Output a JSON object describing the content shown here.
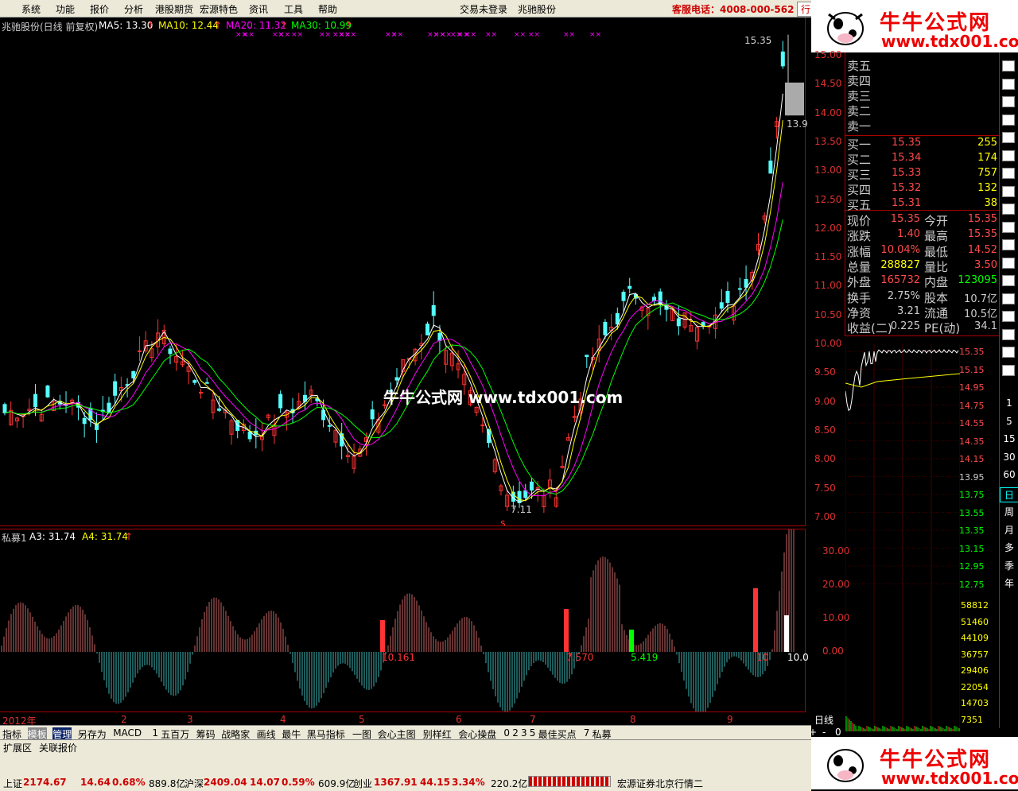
{
  "menu": [
    "系统",
    "功能",
    "报价",
    "分析",
    "港股期货",
    "宏源特色",
    "资讯",
    "工具",
    "帮助"
  ],
  "login_status": "交易未登录",
  "stock_name_menu": "兆驰股份",
  "hotline": "客服电话：4008-000-562",
  "hotline_tab": "行",
  "logo": {
    "title": "牛牛公式网",
    "url": "www.tdx001.com"
  },
  "watermark": "牛牛公式网 www.tdx001.com",
  "main_legend": {
    "name": "兆驰股份(日线 前复权)",
    "ma5": "MA5: 13.30",
    "ma10": "MA10: 12.44",
    "ma20": "MA20: 11.32",
    "ma30": "MA30: 10.99",
    "arrow": "↑"
  },
  "main_y_ticks": [
    "15.00",
    "14.50",
    "14.00",
    "13.50",
    "13.00",
    "12.50",
    "12.00",
    "11.50",
    "11.00",
    "10.50",
    "10.00",
    "9.50",
    "9.00",
    "8.50",
    "8.00",
    "7.50",
    "7.00"
  ],
  "high_label": "15.35",
  "low_label": "7.11",
  "right_low_label": "13.9",
  "sub_legend": {
    "name": "私募1",
    "a3": "A3: 31.74",
    "a4": "A4: 31.74"
  },
  "sub_y_ticks": [
    "30.00",
    "20.00",
    "10.00",
    "0.00"
  ],
  "sub_labels": [
    "10.161",
    "7.570",
    "5.419",
    "10",
    "10.0"
  ],
  "x_labels": [
    "2012年",
    "2",
    "3",
    "4",
    "5",
    "6",
    "7",
    "8",
    "9"
  ],
  "period_label": "日线",
  "zoom_buttons": [
    "+",
    "-",
    "0"
  ],
  "quote": {
    "sells": [
      {
        "label": "卖五"
      },
      {
        "label": "卖四"
      },
      {
        "label": "卖三"
      },
      {
        "label": "卖二"
      },
      {
        "label": "卖一"
      }
    ],
    "buys": [
      {
        "label": "买一",
        "price": "15.35",
        "vol": "255"
      },
      {
        "label": "买二",
        "price": "15.34",
        "vol": "174"
      },
      {
        "label": "买三",
        "price": "15.33",
        "vol": "757"
      },
      {
        "label": "买四",
        "price": "15.32",
        "vol": "132"
      },
      {
        "label": "买五",
        "price": "15.31",
        "vol": "38"
      }
    ],
    "stats": [
      {
        "l1": "现价",
        "v1": "15.35",
        "l2": "今开",
        "v2": "15.35"
      },
      {
        "l1": "涨跌",
        "v1": "1.40",
        "l2": "最高",
        "v2": "15.35"
      },
      {
        "l1": "涨幅",
        "v1": "10.04%",
        "l2": "最低",
        "v2": "14.52"
      },
      {
        "l1": "总量",
        "v1": "288827",
        "l2": "量比",
        "v2": "3.50"
      },
      {
        "l1": "外盘",
        "v1": "165732",
        "l2": "内盘",
        "v2": "123095"
      },
      {
        "l1": "换手",
        "v1": "2.75%",
        "l2": "股本",
        "v2": "10.7亿"
      },
      {
        "l1": "净资",
        "v1": "3.21",
        "l2": "流通",
        "v2": "10.5亿"
      },
      {
        "l1": "收益(二)",
        "v1": "0.225",
        "l2": "PE(动)",
        "v2": "34.1"
      }
    ]
  },
  "mini_price_ticks": [
    "15.35",
    "15.15",
    "14.95",
    "14.75",
    "14.55",
    "14.35",
    "14.15",
    "13.95",
    "13.75",
    "13.55",
    "13.35",
    "13.15",
    "12.95",
    "12.75"
  ],
  "mini_vol_ticks": [
    "58812",
    "51460",
    "44109",
    "36757",
    "29406",
    "22054",
    "14703",
    "7351"
  ],
  "right_tools": [
    "1",
    "5",
    "15",
    "30",
    "60",
    "日",
    "周",
    "月",
    "多",
    "季",
    "年"
  ],
  "bottom_tabs": [
    "指标",
    "模板",
    "管理",
    "另存为",
    "MACD",
    "1",
    "五百万",
    "筹码",
    "战略家",
    "画线",
    "最牛",
    "黑马指标",
    "一图",
    "会心主图",
    "别样红",
    "会心操盘",
    "0",
    "2",
    "3",
    "5",
    "最佳买点",
    "7",
    "私募"
  ],
  "sub_tabs": [
    "扩展区",
    "关联报价"
  ],
  "status": {
    "sh_label": "上证",
    "sh_val": "2174.67",
    "sh_chg": "14.64",
    "sh_pct": "0.68%",
    "sh_amt": "889.8亿",
    "sz_label": "沪深",
    "sz_val": "2409.04",
    "sz_chg": "14.07",
    "sz_pct": "0.59%",
    "sz_amt": "609.9亿",
    "cy_label": "创业",
    "cy_val": "1367.91",
    "cy_chg": "44.15",
    "cy_pct": "3.34%",
    "cy_amt": "220.2亿",
    "broker": "宏源证券北京行情二"
  },
  "colors": {
    "up": "#ff3232",
    "down": "#54ffff",
    "ma5": "#ffffff",
    "ma10": "#ffff00",
    "ma20": "#ff00ff",
    "ma30": "#00ff00",
    "axis": "#a00000"
  }
}
